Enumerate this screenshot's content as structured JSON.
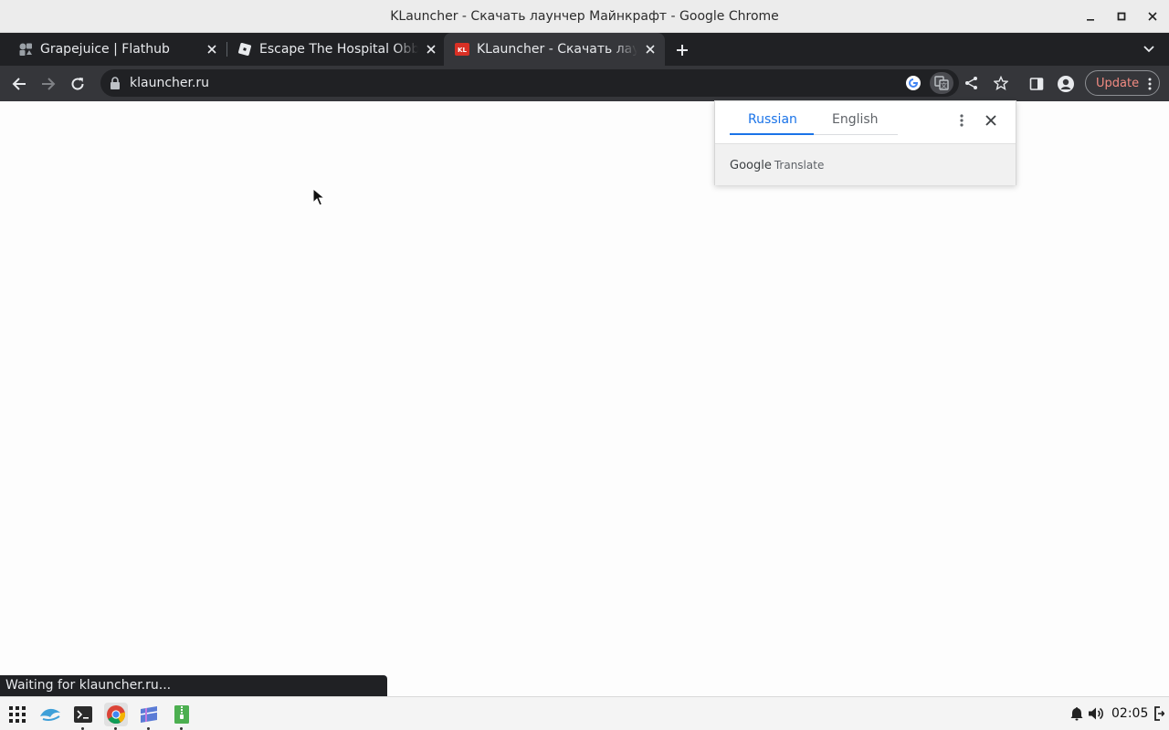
{
  "window": {
    "title": "KLauncher - Скачать лаунчер Майнкрафт - Google Chrome"
  },
  "tabs": [
    {
      "label": "Grapejuice | Flathub",
      "favicon": "flathub-icon",
      "active": false
    },
    {
      "label": "Escape The Hospital Obby",
      "favicon": "roblox-icon",
      "active": false
    },
    {
      "label": "KLauncher - Скачать лаунчер Майнкрафт",
      "favicon": "klauncher-icon",
      "active": true
    }
  ],
  "toolbar": {
    "url": "klauncher.ru",
    "update_label": "Update"
  },
  "translate_popup": {
    "source_language": "Russian",
    "target_language": "English",
    "brand_google": "Google",
    "brand_translate": "Translate"
  },
  "status": {
    "text": "Waiting for klauncher.ru..."
  },
  "taskbar": {
    "apps": [
      "app-grid-icon",
      "dolphin-icon",
      "terminal-icon",
      "chrome-icon",
      "window-manager-icon",
      "archive-manager-icon"
    ],
    "clock": "02:05"
  },
  "colors": {
    "tabstrip": "#202124",
    "toolbar": "#35363a",
    "accent": "#1a73e8",
    "update": "#f28b82"
  }
}
